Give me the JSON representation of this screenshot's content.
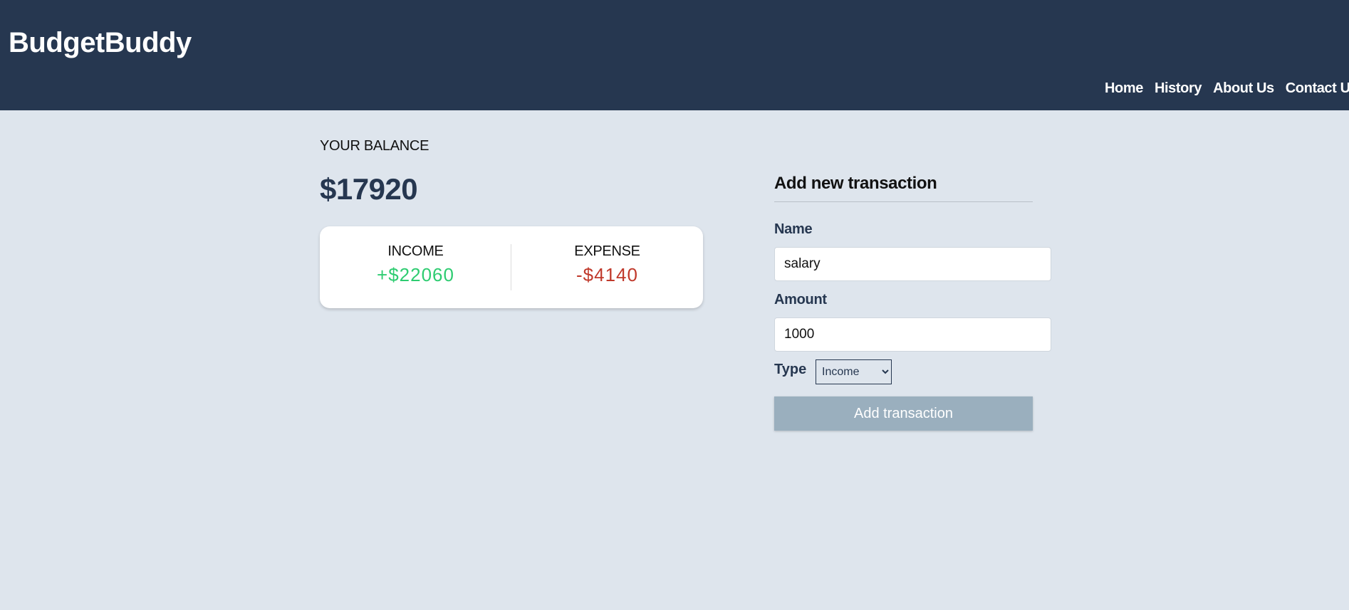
{
  "header": {
    "brand": "BudgetBuddy",
    "nav": [
      "Home",
      "History",
      "About Us",
      "Contact Us"
    ]
  },
  "balance": {
    "label": "YOUR BALANCE",
    "value": "$17920"
  },
  "summary": {
    "income_label": "INCOME",
    "income_value": "+$22060",
    "expense_label": "EXPENSE",
    "expense_value": "-$4140"
  },
  "form": {
    "title": "Add new transaction",
    "name_label": "Name",
    "name_value": "salary",
    "amount_label": "Amount",
    "amount_value": "1000",
    "type_label": "Type",
    "type_selected": "Income",
    "submit_label": "Add transaction"
  },
  "colors": {
    "header_bg": "#263750",
    "page_bg": "#dee5ed",
    "income": "#2ecc71",
    "expense": "#c0392b",
    "button": "#9aafbe"
  }
}
